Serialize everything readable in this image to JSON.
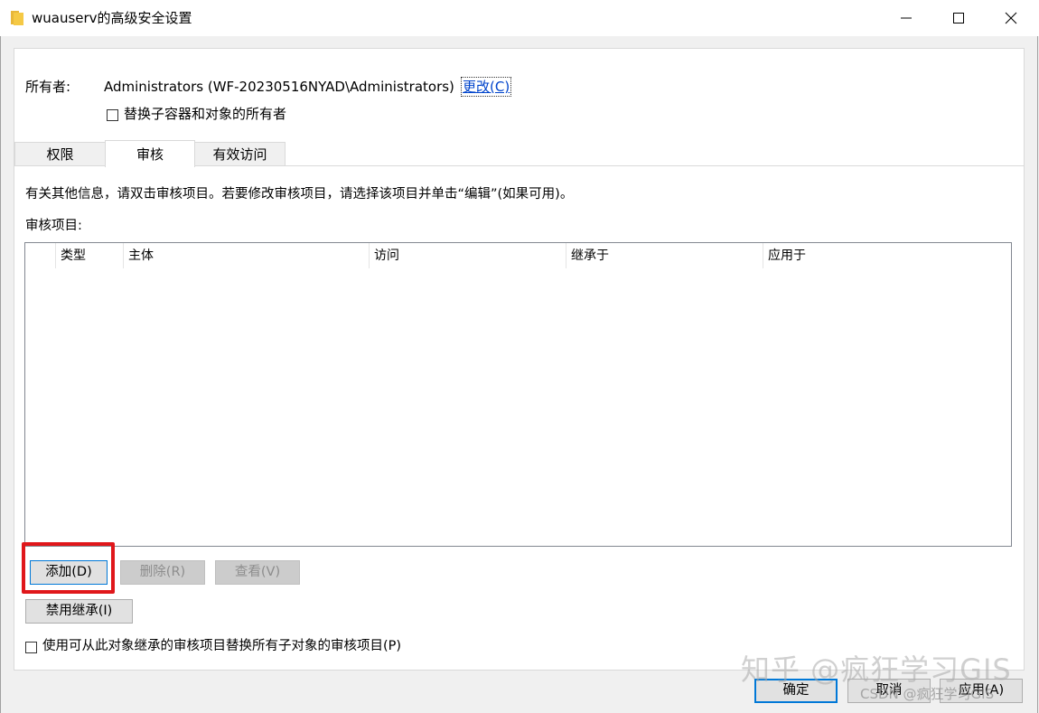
{
  "window": {
    "title": "wuauserv的高级安全设置",
    "folder_icon": "folder-icon",
    "controls": {
      "minimize_icon": "minimize-icon",
      "maximize_icon": "maximize-icon",
      "close_icon": "close-icon"
    }
  },
  "owner": {
    "label": "所有者:",
    "value": "Administrators (WF-20230516NYAD\\Administrators)",
    "change_link": "更改(C)",
    "replace_checkbox_label": "替换子容器和对象的所有者",
    "replace_checked": false
  },
  "tabs": [
    {
      "label": "权限",
      "selected": false
    },
    {
      "label": "审核",
      "selected": true
    },
    {
      "label": "有效访问",
      "selected": false
    }
  ],
  "audit": {
    "info": "有关其他信息，请双击审核项目。若要修改审核项目，请选择该项目并单击“编辑”(如果可用)。",
    "entries_label": "审核项目:",
    "columns": [
      "类型",
      "主体",
      "访问",
      "继承于",
      "应用于"
    ],
    "rows": [],
    "buttons": {
      "add": "添加(D)",
      "remove": "删除(R)",
      "view": "查看(V)",
      "disable_inheritance": "禁用继承(I)"
    },
    "replace_children_label": "使用可从此对象继承的审核项目替换所有子对象的审核项目(P)",
    "replace_children_checked": false
  },
  "footer": {
    "ok": "确定",
    "cancel": "取消",
    "apply": "应用(A)"
  },
  "watermark": {
    "main": "知乎 @疯狂学习GIS",
    "secondary": "CSDN @疯狂学习GIS"
  },
  "colors": {
    "highlight": "#e0171b",
    "link": "#0044cc",
    "focus": "#0078d7",
    "folder": "#f5c945"
  }
}
